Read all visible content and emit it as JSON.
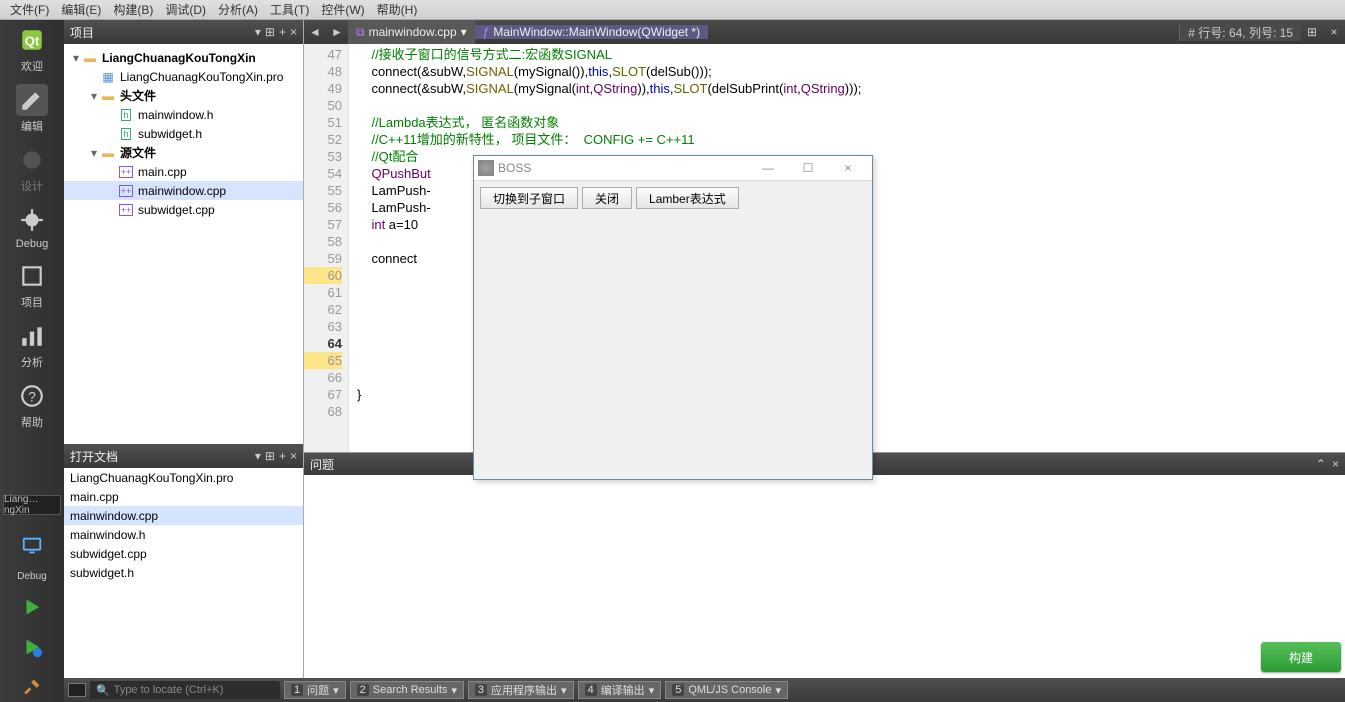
{
  "menu": [
    "文件(F)",
    "编辑(E)",
    "构建(B)",
    "调试(D)",
    "分析(A)",
    "工具(T)",
    "控件(W)",
    "帮助(H)"
  ],
  "activity": {
    "modes": [
      {
        "label": "欢迎",
        "icon": "qt"
      },
      {
        "label": "编辑",
        "icon": "edit",
        "selected": true
      },
      {
        "label": "设计",
        "icon": "design",
        "disabled": true
      },
      {
        "label": "Debug",
        "icon": "debug"
      },
      {
        "label": "项目",
        "icon": "projects"
      },
      {
        "label": "分析",
        "icon": "analyze"
      },
      {
        "label": "帮助",
        "icon": "help"
      }
    ],
    "target": "Liang…ngXin",
    "target2": "Debug"
  },
  "project_panel": {
    "title": "项目",
    "tree": [
      {
        "d": 0,
        "exp": "open",
        "icon": "proj",
        "bold": true,
        "label": "LiangChuanagKouTongXin"
      },
      {
        "d": 1,
        "exp": "none",
        "icon": "pro",
        "label": "LiangChuanagKouTongXin.pro"
      },
      {
        "d": 1,
        "exp": "open",
        "icon": "folder",
        "bold": true,
        "label": "头文件"
      },
      {
        "d": 2,
        "exp": "none",
        "icon": "h",
        "label": "mainwindow.h"
      },
      {
        "d": 2,
        "exp": "none",
        "icon": "h",
        "label": "subwidget.h"
      },
      {
        "d": 1,
        "exp": "open",
        "icon": "folder",
        "bold": true,
        "label": "源文件"
      },
      {
        "d": 2,
        "exp": "none",
        "icon": "cpp",
        "label": "main.cpp"
      },
      {
        "d": 2,
        "exp": "none",
        "icon": "cpp",
        "label": "mainwindow.cpp",
        "selected": true
      },
      {
        "d": 2,
        "exp": "none",
        "icon": "cpp",
        "label": "subwidget.cpp"
      }
    ]
  },
  "opendocs_panel": {
    "title": "打开文档",
    "items": [
      {
        "label": "LiangChuanagKouTongXin.pro"
      },
      {
        "label": "main.cpp"
      },
      {
        "label": "mainwindow.cpp",
        "selected": true
      },
      {
        "label": "mainwindow.h"
      },
      {
        "label": "subwidget.cpp"
      },
      {
        "label": "subwidget.h"
      }
    ]
  },
  "editor": {
    "crumb_file": "mainwindow.cpp",
    "crumb_func": "MainWindow::MainWindow(QWidget *)",
    "status_right": "#  行号: 64, 列号: 15",
    "first_line": 47,
    "last_line": 68,
    "current_line": 64,
    "code": {
      "47": [
        [
          "c",
          "//接收子窗口的信号方式二:宏函数SIGNAL"
        ]
      ],
      "48": [
        [
          "n",
          "connect(&subW,"
        ],
        [
          "o",
          "SIGNAL"
        ],
        [
          "n",
          "(mySignal()),"
        ],
        [
          "k",
          "this"
        ],
        [
          "n",
          ","
        ],
        [
          "o",
          "SLOT"
        ],
        [
          "n",
          "(delSub()));"
        ]
      ],
      "49": [
        [
          "n",
          "connect(&subW,"
        ],
        [
          "o",
          "SIGNAL"
        ],
        [
          "n",
          "(mySignal("
        ],
        [
          "t",
          "int"
        ],
        [
          "n",
          ","
        ],
        [
          "t",
          "QString"
        ],
        [
          "n",
          ")),"
        ],
        [
          "k",
          "this"
        ],
        [
          "n",
          ","
        ],
        [
          "o",
          "SLOT"
        ],
        [
          "n",
          "(delSubPrint("
        ],
        [
          "t",
          "int"
        ],
        [
          "n",
          ","
        ],
        [
          "t",
          "QString"
        ],
        [
          "n",
          ")));"
        ]
      ],
      "50": [
        [
          "n",
          ""
        ]
      ],
      "51": [
        [
          "c",
          "//Lambda表达式， 匿名函数对象"
        ]
      ],
      "52": [
        [
          "c",
          "//C++11增加的新特性，"
        ],
        [
          "c",
          " 项目文件："
        ],
        [
          "c",
          "  CONFIG += C++11"
        ]
      ],
      "53": [
        [
          "c",
          "//Qt配合"
        ]
      ],
      "54": [
        [
          "t",
          "QPushBut"
        ]
      ],
      "55": [
        [
          "n",
          "LamPush-"
        ]
      ],
      "56": [
        [
          "n",
          "LamPush-"
        ]
      ],
      "57": [
        [
          "t",
          "int"
        ],
        [
          "n",
          " a=10"
        ]
      ],
      "58": [
        [
          "n",
          ""
        ]
      ],
      "59": [
        [
          "n",
          "connect"
        ]
      ],
      "60": [
        [
          "n",
          ""
        ]
      ],
      "61": [
        [
          "n",
          ""
        ]
      ],
      "62": [
        [
          "n",
          ""
        ]
      ],
      "63": [
        [
          "n",
          ""
        ]
      ],
      "64": [
        [
          "n",
          ""
        ]
      ],
      "65": [
        [
          "n",
          ""
        ]
      ],
      "66": [
        [
          "n",
          ""
        ]
      ],
      "67": [
        [
          "n",
          "}"
        ]
      ],
      "68": [
        [
          "n",
          ""
        ]
      ]
    }
  },
  "problems": {
    "title": "问题"
  },
  "bottom": {
    "locator_placeholder": "Type to locate (Ctrl+K)",
    "tabs": [
      {
        "n": "1",
        "label": "问题"
      },
      {
        "n": "2",
        "label": "Search Results"
      },
      {
        "n": "3",
        "label": "应用程序输出"
      },
      {
        "n": "4",
        "label": "编译输出"
      },
      {
        "n": "5",
        "label": "QML/JS Console"
      }
    ]
  },
  "dialog": {
    "title": "BOSS",
    "buttons": [
      "切换到子窗口",
      "关闭",
      "Lamber表达式"
    ]
  },
  "build_badge": "构建",
  "panel_hdr_icons": {
    "filter": "▾",
    "split": "⊞",
    "add": "+",
    "close": "×",
    "min": "—",
    "max": "☐",
    "expand": "⌃"
  }
}
